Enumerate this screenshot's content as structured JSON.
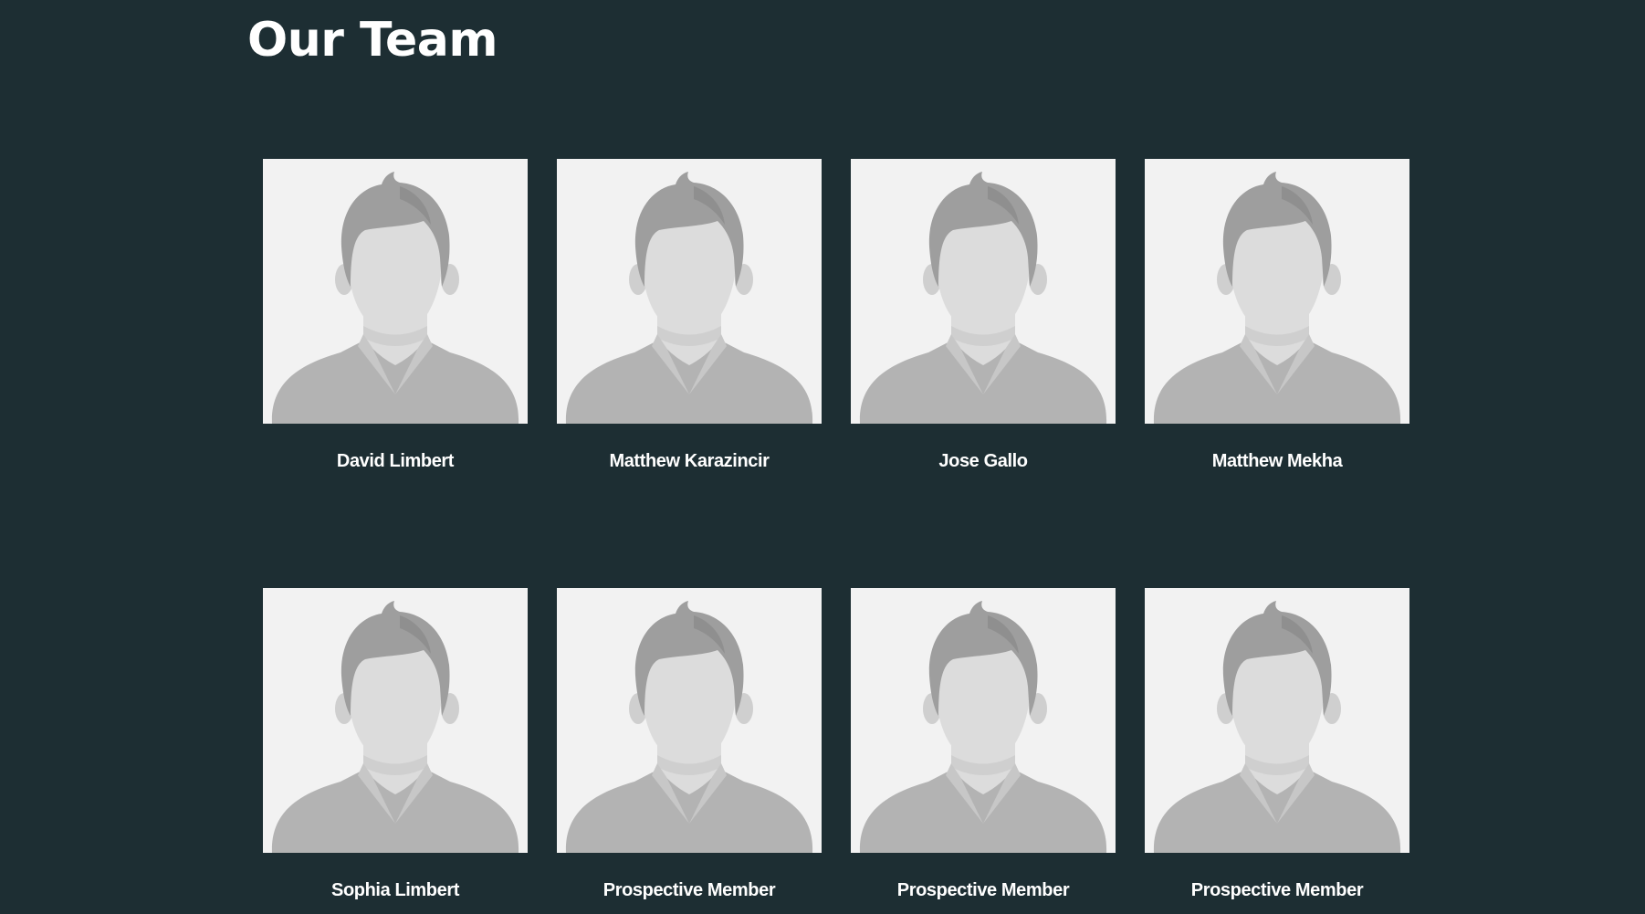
{
  "page": {
    "title": "Our Team",
    "colors": {
      "background": "#1d2e33",
      "text": "#ffffff",
      "avatar_bg": "#f2f2f2",
      "avatar_hair": "#9e9e9e",
      "avatar_skin": "#dcdcdc",
      "avatar_body": "#b3b3b3"
    }
  },
  "team": {
    "members": [
      {
        "name": "David Limbert",
        "avatar_icon": "person-placeholder-icon"
      },
      {
        "name": "Matthew Karazincir",
        "avatar_icon": "person-placeholder-icon"
      },
      {
        "name": "Jose Gallo",
        "avatar_icon": "person-placeholder-icon"
      },
      {
        "name": "Matthew Mekha",
        "avatar_icon": "person-placeholder-icon"
      },
      {
        "name": "Sophia Limbert",
        "avatar_icon": "person-placeholder-icon"
      },
      {
        "name": "Prospective Member",
        "avatar_icon": "person-placeholder-icon"
      },
      {
        "name": "Prospective Member",
        "avatar_icon": "person-placeholder-icon"
      },
      {
        "name": "Prospective Member",
        "avatar_icon": "person-placeholder-icon"
      }
    ]
  }
}
